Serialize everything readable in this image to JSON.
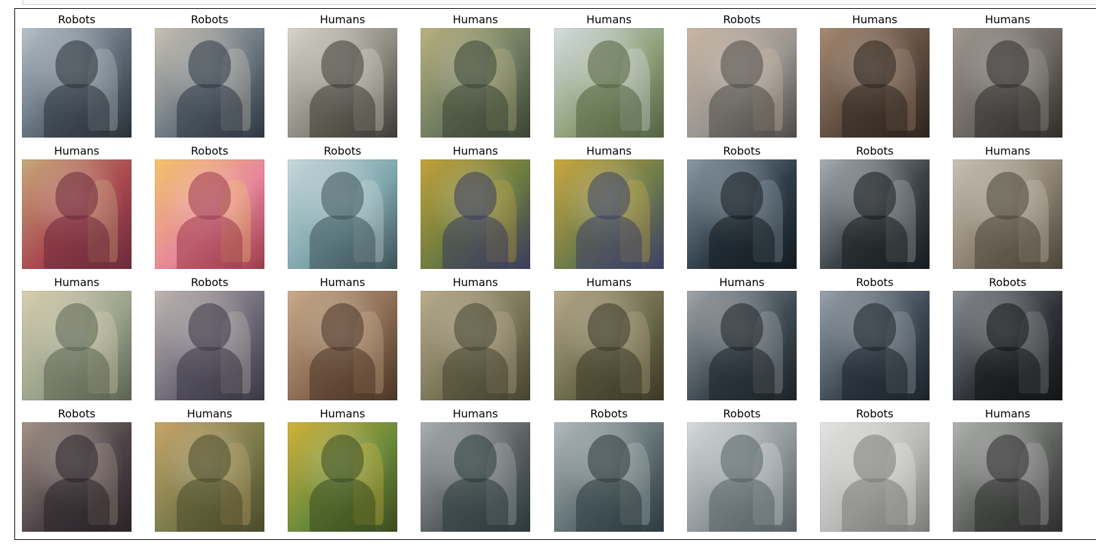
{
  "grid": {
    "rows": [
      [
        {
          "label": "Robots",
          "c1": "#5e6b77",
          "c2": "#b7c2c9",
          "c3": "#2a3138"
        },
        {
          "label": "Robots",
          "c1": "#6b7680",
          "c2": "#c9c2b4",
          "c3": "#2d3641"
        },
        {
          "label": "Humans",
          "c1": "#8c8a80",
          "c2": "#d8d6cc",
          "c3": "#3b3a33"
        },
        {
          "label": "Humans",
          "c1": "#6e7a5f",
          "c2": "#b9b27f",
          "c3": "#3a4433"
        },
        {
          "label": "Humans",
          "c1": "#8fa07a",
          "c2": "#d6dde2",
          "c3": "#52613f"
        },
        {
          "label": "Robots",
          "c1": "#9a9590",
          "c2": "#c9b6a3",
          "c3": "#4e4a46"
        },
        {
          "label": "Humans",
          "c1": "#5e4c40",
          "c2": "#a68a72",
          "c3": "#2e241d"
        },
        {
          "label": "Humans",
          "c1": "#6a6662",
          "c2": "#9f9790",
          "c3": "#2f2c29"
        }
      ],
      [
        {
          "label": "Humans",
          "c1": "#a8484f",
          "c2": "#c8a87a",
          "c3": "#6b2a3a"
        },
        {
          "label": "Robots",
          "c1": "#e6879a",
          "c2": "#f2c36c",
          "c3": "#9a3a4a"
        },
        {
          "label": "Robots",
          "c1": "#7fa6ad",
          "c2": "#c8d8db",
          "c3": "#3d5257"
        },
        {
          "label": "Humans",
          "c1": "#6a7a3f",
          "c2": "#c2a23a",
          "c3": "#3a3a5e"
        },
        {
          "label": "Humans",
          "c1": "#6d7a4a",
          "c2": "#c9a83e",
          "c3": "#3d3f66"
        },
        {
          "label": "Robots",
          "c1": "#2f3d48",
          "c2": "#8a9aa5",
          "c3": "#141b21"
        },
        {
          "label": "Robots",
          "c1": "#3c4348",
          "c2": "#a7aeb3",
          "c3": "#171b1e"
        },
        {
          "label": "Humans",
          "c1": "#8a8070",
          "c2": "#c8c2b3",
          "c3": "#4a4539"
        }
      ],
      [
        {
          "label": "Humans",
          "c1": "#9aa28a",
          "c2": "#d8cfb0",
          "c3": "#5b6250"
        },
        {
          "label": "Robots",
          "c1": "#6e6a78",
          "c2": "#c0b7b2",
          "c3": "#3a3744"
        },
        {
          "label": "Humans",
          "c1": "#8a6a52",
          "c2": "#c9ab8a",
          "c3": "#4a3526"
        },
        {
          "label": "Humans",
          "c1": "#7a7558",
          "c2": "#b9ad8e",
          "c3": "#46432f"
        },
        {
          "label": "Humans",
          "c1": "#6b6a4a",
          "c2": "#b7a98a",
          "c3": "#3a3826"
        },
        {
          "label": "Humans",
          "c1": "#3f4a52",
          "c2": "#a0a6aa",
          "c3": "#1c2328"
        },
        {
          "label": "Robots",
          "c1": "#3e4a55",
          "c2": "#9aa3aa",
          "c3": "#1b232a"
        },
        {
          "label": "Robots",
          "c1": "#2f3236",
          "c2": "#8b8f93",
          "c3": "#121416"
        }
      ],
      [
        {
          "label": "Robots",
          "c1": "#4d4448",
          "c2": "#a39387",
          "c3": "#2a2326"
        },
        {
          "label": "Humans",
          "c1": "#7a7a4a",
          "c2": "#c7a66a",
          "c3": "#4a4a2a"
        },
        {
          "label": "Humans",
          "c1": "#6a8a3a",
          "c2": "#d1b23a",
          "c3": "#3a4a1f"
        },
        {
          "label": "Humans",
          "c1": "#5a5f62",
          "c2": "#aab0b2",
          "c3": "#2a3a3a"
        },
        {
          "label": "Robots",
          "c1": "#5f6f72",
          "c2": "#b3bbbe",
          "c3": "#2b3a3e"
        },
        {
          "label": "Robots",
          "c1": "#8e9699",
          "c2": "#d6dbdc",
          "c3": "#566063"
        },
        {
          "label": "Robots",
          "c1": "#b8b8b6",
          "c2": "#e4e4e2",
          "c3": "#7a7a78"
        },
        {
          "label": "Humans",
          "c1": "#5e605e",
          "c2": "#b1b3b1",
          "c3": "#2c2e2c"
        }
      ]
    ]
  }
}
